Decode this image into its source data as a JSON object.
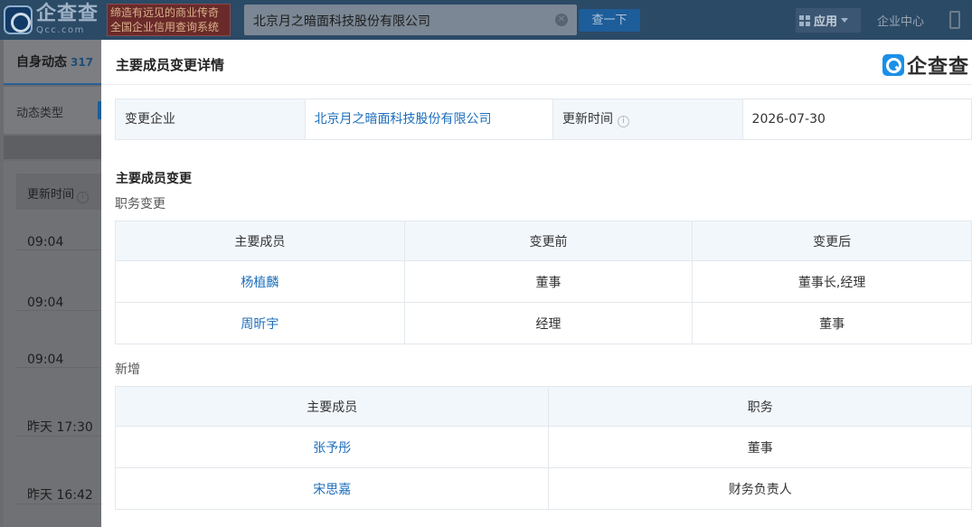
{
  "header": {
    "logo_cn": "企查查",
    "logo_en": "Qcc.com",
    "slogan_line1": "缔造有远见的商业传奇",
    "slogan_line2": "全国企业信用查询系统",
    "search_value": "北京月之暗面科技股份有限公司",
    "search_button": "查一下",
    "apps_label": "应用",
    "enterprise_center": "企业中心"
  },
  "background": {
    "tab_label": "自身动态",
    "tab_count": "317",
    "filter_label": "动态类型",
    "col_header": "更新时间",
    "times": [
      "09:04",
      "09:04",
      "09:04",
      "昨天 17:30",
      "昨天 16:42"
    ]
  },
  "modal": {
    "title": "主要成员变更详情",
    "brand": "企查查",
    "info": {
      "company_label": "变更企业",
      "company_value": "北京月之暗面科技股份有限公司",
      "time_label": "更新时间",
      "time_value": "2026-07-30"
    },
    "section_title": "主要成员变更",
    "position_change": {
      "subtitle": "职务变更",
      "headers": [
        "主要成员",
        "变更前",
        "变更后"
      ],
      "rows": [
        {
          "name": "杨植麟",
          "before": "董事",
          "after": "董事长,经理"
        },
        {
          "name": "周昕宇",
          "before": "经理",
          "after": "董事"
        }
      ]
    },
    "added": {
      "subtitle": "新增",
      "headers": [
        "主要成员",
        "职务"
      ],
      "rows": [
        {
          "name": "张予彤",
          "position": "董事"
        },
        {
          "name": "宋思嘉",
          "position": "财务负责人"
        }
      ]
    }
  },
  "colors": {
    "link_blue": "#1d6fbb",
    "header_bg": "#f2f7fc",
    "brand_blue": "#1b8fe8"
  }
}
